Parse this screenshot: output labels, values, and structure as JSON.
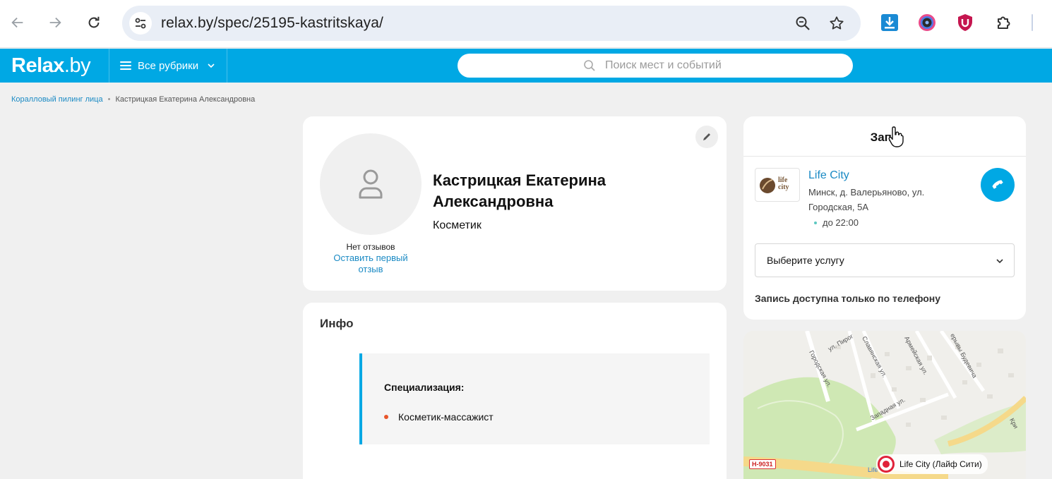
{
  "browser": {
    "url": "relax.by/spec/25195-kastritskaya/"
  },
  "header": {
    "logo_main": "Relax",
    "logo_tld": ".by",
    "rubrics_label": "Все рубрики",
    "search_placeholder": "Поиск мест и событий"
  },
  "breadcrumb": {
    "items": [
      "Коралловый пилинг лица",
      "Кастрицкая Екатерина Александровна"
    ]
  },
  "profile": {
    "name": "Кастрицкая Екатерина Александровна",
    "role": "Косметик",
    "no_reviews": "Нет отзывов",
    "leave_review": "Оставить первый отзыв"
  },
  "info": {
    "title": "Инфо",
    "spec_label": "Специализация:",
    "spec_items": [
      "Косметик-массажист"
    ]
  },
  "booking": {
    "title": "Запи",
    "salon_name": "Life City",
    "salon_logo_text": "life city",
    "salon_address": "Минск, д. Валерьяново, ул. Городская, 5А",
    "salon_hours": "до 22:00",
    "service_placeholder": "Выберите услугу",
    "phone_note": "Запись доступна только по телефону"
  },
  "map": {
    "road_badge": "Н-9031",
    "place_label": "Life City (Лайф Сити)",
    "streets": [
      "ул. Пирог",
      "Городская ул.",
      "Славянская ул.",
      "Армейская ул.",
      "Западная ул.",
      "ерывы Будевича",
      "Кри",
      "Life"
    ]
  },
  "colors": {
    "brand": "#00a8e4",
    "link": "#1a8ac4",
    "bullet": "#e8552a",
    "pin": "#e0223a"
  }
}
